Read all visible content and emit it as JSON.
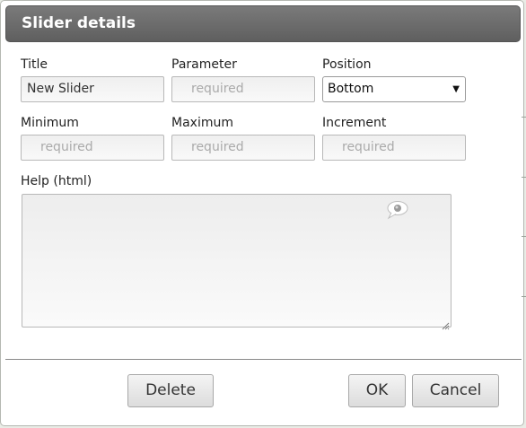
{
  "dialog": {
    "title": "Slider details"
  },
  "fields": {
    "title": {
      "label": "Title",
      "value": "New Slider"
    },
    "parameter": {
      "label": "Parameter",
      "placeholder": "required"
    },
    "position": {
      "label": "Position",
      "selected": "Bottom"
    },
    "minimum": {
      "label": "Minimum",
      "placeholder": "required"
    },
    "maximum": {
      "label": "Maximum",
      "placeholder": "required"
    },
    "increment": {
      "label": "Increment",
      "placeholder": "required"
    },
    "help": {
      "label": "Help (html)",
      "value": ""
    }
  },
  "buttons": {
    "delete": "Delete",
    "ok": "OK",
    "cancel": "Cancel"
  },
  "icons": {
    "help_bubble": "speech-bubble-icon",
    "resize": "resize-grip-icon",
    "dropdown": "chevron-down-icon"
  }
}
